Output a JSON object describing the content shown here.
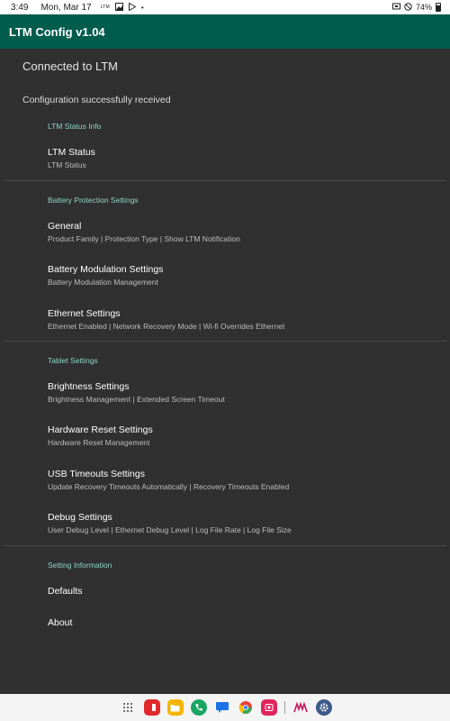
{
  "status_bar": {
    "time": "3:49",
    "date": "Mon, Mar 17",
    "ltm_indicator": "LTM",
    "battery_percent": "74%",
    "icons": [
      "image-icon",
      "play-store-icon",
      "dot-icon",
      "cast-icon",
      "mute-icon",
      "battery-icon"
    ]
  },
  "app_bar": {
    "title": "LTM Config v1.04"
  },
  "main": {
    "connection_status": "Connected to LTM",
    "config_message": "Configuration successfully received",
    "sections": [
      {
        "header": "LTM Status Info",
        "items": [
          {
            "title": "LTM Status",
            "summary": "LTM Status"
          }
        ]
      },
      {
        "header": "Battery Protection Settings",
        "items": [
          {
            "title": "General",
            "summary": "Product Family | Protection Type | Show LTM Notification"
          },
          {
            "title": "Battery Modulation Settings",
            "summary": "Battery Modulation Management"
          },
          {
            "title": "Ethernet Settings",
            "summary": "Ethernet Enabled | Network Recovery Mode | Wi-fi Overrides Ethernet"
          }
        ]
      },
      {
        "header": "Tablet Settings",
        "items": [
          {
            "title": "Brightness Settings",
            "summary": "Brightness Management | Extended Screen Timeout"
          },
          {
            "title": "Hardware Reset Settings",
            "summary": "Hardware Reset Management"
          },
          {
            "title": "USB Timeouts Settings",
            "summary": "Update Recovery Timeouts Automatically | Recovery Timeouts Enabled"
          },
          {
            "title": "Debug Settings",
            "summary": "User Debug Level | Ethernet Debug Level | Log File Rate | Log File Size"
          }
        ]
      },
      {
        "header": "Setting Information",
        "items": [
          {
            "title": "Defaults"
          },
          {
            "title": "About"
          }
        ]
      }
    ]
  },
  "taskbar": {
    "apps": [
      "app-drawer-icon",
      "flipboard-icon",
      "files-icon",
      "phone-icon",
      "messages-icon",
      "chrome-icon",
      "screen-recorder-icon",
      "notes-icon",
      "settings-icon"
    ],
    "colors": {
      "flipboard": "#e02a2a",
      "files": "#f5b400",
      "phone": "#1aa463",
      "messages": "#1a73e8",
      "chrome": "#34a853",
      "recorder": "#e0245e",
      "notes": "#c2185b",
      "settings": "#3c5a8a"
    }
  },
  "colors": {
    "app_bar": "#005c4b",
    "background": "#303030",
    "category_text": "#8fd6c6"
  }
}
